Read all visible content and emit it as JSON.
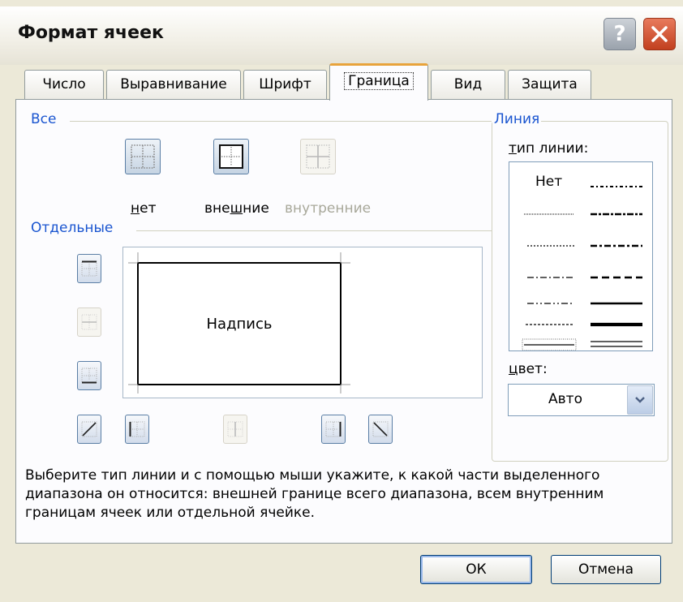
{
  "window": {
    "title": "Формат ячеек"
  },
  "titlebar_buttons": {
    "help": "?",
    "close_icon": "close-icon"
  },
  "tabs": [
    {
      "label": "Число",
      "active": false
    },
    {
      "label": "Выравнивание",
      "active": false
    },
    {
      "label": "Шрифт",
      "active": false
    },
    {
      "label": "Граница",
      "active": true
    },
    {
      "label": "Вид",
      "active": false
    },
    {
      "label": "Защита",
      "active": false
    }
  ],
  "presets_group": {
    "label": "Все",
    "items": [
      {
        "label_prefix": "",
        "label_accel": "н",
        "label_rest": "ет",
        "enabled": true
      },
      {
        "label_prefix": "вне",
        "label_accel": "ш",
        "label_rest": "ние",
        "enabled": true
      },
      {
        "label_prefix": "внутренние",
        "label_accel": "",
        "label_rest": "",
        "enabled": false
      }
    ]
  },
  "border_group": {
    "label": "Отдельные"
  },
  "preview": {
    "text": "Надпись"
  },
  "line_group": {
    "label": "Линия",
    "type_label_accel": "т",
    "type_label_rest": "ип линии:",
    "none_label": "Нет",
    "color_label_accel": "ц",
    "color_label_rest": "вет:",
    "color_value": "Авто"
  },
  "description": "Выберите тип линии и с помощью мыши укажите, к какой части выделенного диапазона он относится: внешней границе всего диапазона, всем внутренним границам ячеек или отдельной ячейке.",
  "buttons": {
    "ok": "ОК",
    "cancel": "Отмена"
  },
  "colors": {
    "accent_tab": "#e8a33b",
    "group_label": "#1a55d0",
    "dialog_bg": "#ece9d8",
    "close_red": "#c2401f"
  }
}
